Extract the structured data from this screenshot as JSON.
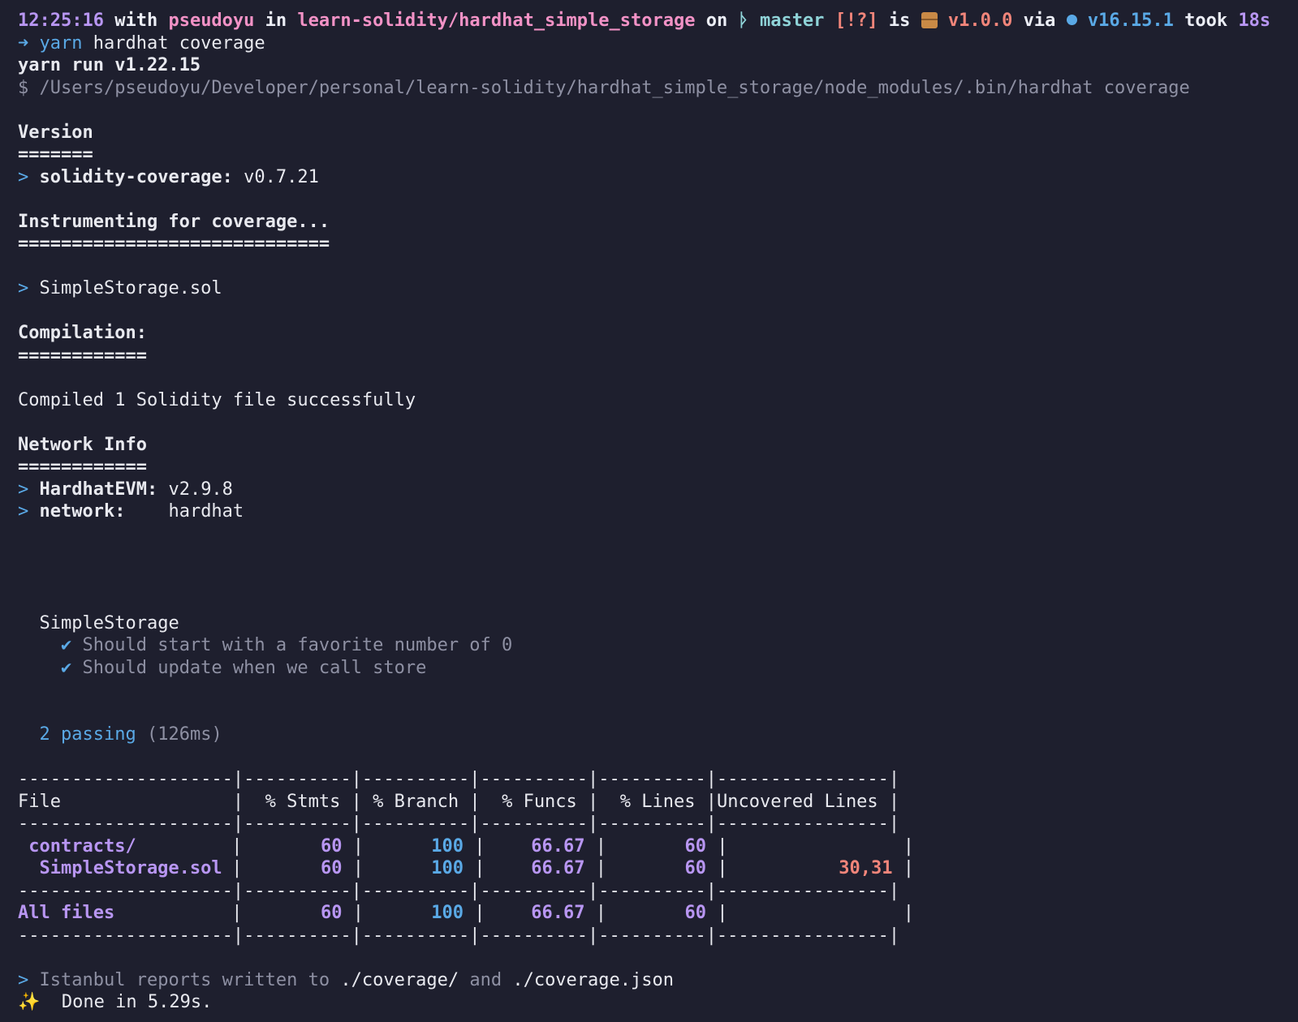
{
  "prompt": {
    "time": "12:25:16",
    "with_word": "with",
    "user": "pseudoyu",
    "in_word": "in",
    "dir": "learn-solidity/hardhat_simple_storage",
    "on_word": "on",
    "branch_icon": "git-branch-icon",
    "branch_glyph": "ᚦ",
    "branch": "master",
    "git_status": "[!?]",
    "is_word": "is",
    "package_icon": "package-icon",
    "pkg_version": "v1.0.0",
    "via_word": "via",
    "node_icon": "nodejs-icon",
    "node_version": "v16.15.1",
    "took_word": "took",
    "duration": "18s"
  },
  "command": {
    "arrow": "➜",
    "program": "yarn",
    "args": "hardhat coverage"
  },
  "output": {
    "yarn_run": "yarn run v1.22.15",
    "exec_line": "$ /Users/pseudoyu/Developer/personal/learn-solidity/hardhat_simple_storage/node_modules/.bin/hardhat coverage",
    "version_title": "Version",
    "version_rule": "=======",
    "cov_key": "solidity-coverage:",
    "cov_val": "v0.7.21",
    "instr_title": "Instrumenting for coverage...",
    "instr_rule": "=============================",
    "instr_file": "SimpleStorage.sol",
    "compile_title": "Compilation:",
    "compile_rule": "============",
    "compiled_msg": "Compiled 1 Solidity file successfully",
    "network_title": "Network Info",
    "network_rule": "============",
    "evm_key": "HardhatEVM:",
    "evm_val": "v2.9.8",
    "net_key": "network:",
    "net_val": "hardhat",
    "prompt_marker": ">",
    "suite": "SimpleStorage",
    "check": "✔",
    "tests": [
      "Should start with a favorite number of 0",
      "Should update when we call store"
    ],
    "passing": "2 passing",
    "passing_time": "(126ms)",
    "istanbul_pre": "Istanbul reports written to",
    "istanbul_dir": "./coverage/",
    "istanbul_and": "and",
    "istanbul_json": "./coverage.json",
    "sparkle": "✨",
    "done": "Done in 5.29s."
  },
  "table": {
    "border": "--------------------|----------|----------|----------|----------|----------------|",
    "headers": [
      "File",
      "% Stmts",
      "% Branch",
      "% Funcs",
      "% Lines",
      "Uncovered Lines"
    ],
    "rows": [
      {
        "file": " contracts/",
        "stmts": "60",
        "branch": "100",
        "funcs": "66.67",
        "lines": "60",
        "uncovered": ""
      },
      {
        "file": "  SimpleStorage.sol",
        "stmts": "60",
        "branch": "100",
        "funcs": "66.67",
        "lines": "60",
        "uncovered": "30,31"
      }
    ],
    "total": {
      "file": "All files",
      "stmts": "60",
      "branch": "100",
      "funcs": "66.67",
      "lines": "60",
      "uncovered": ""
    }
  },
  "colors": {
    "background": "#1e1f2e",
    "purple": "#b896f2",
    "pink": "#f292c6",
    "teal": "#8fd3d8",
    "salmon": "#f2857a",
    "blue": "#5aa9e6"
  }
}
